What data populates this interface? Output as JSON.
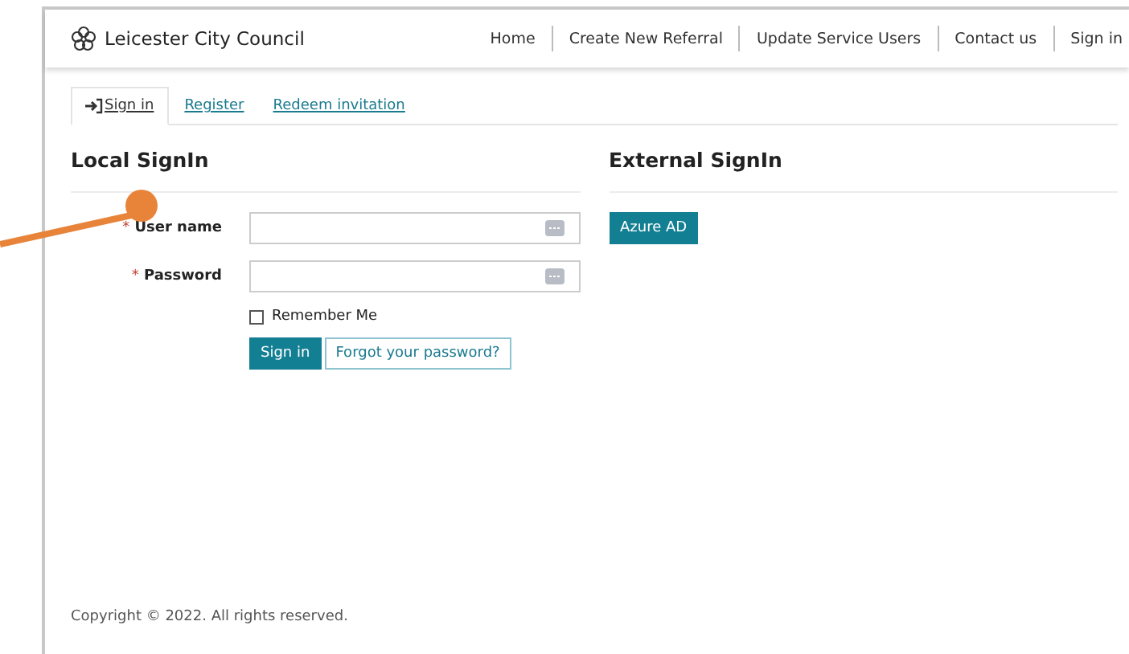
{
  "header": {
    "brand": "Leicester City Council",
    "nav": [
      {
        "label": "Home"
      },
      {
        "label": "Create New Referral"
      },
      {
        "label": "Update Service Users"
      },
      {
        "label": "Contact us"
      },
      {
        "label": "Sign in"
      }
    ]
  },
  "tabs": [
    {
      "label": "Sign in",
      "selected": true,
      "kind": "icon"
    },
    {
      "label": "Register",
      "selected": false,
      "kind": "plain"
    },
    {
      "label": "Redeem invitation",
      "selected": false,
      "kind": "plain"
    }
  ],
  "local": {
    "title": "Local SignIn",
    "fields": [
      {
        "label": "User name",
        "required_mark": "*"
      },
      {
        "label": "Password",
        "required_mark": "*"
      }
    ],
    "remember": {
      "label": "Remember Me",
      "checked": false
    },
    "submit": "Sign in",
    "forgot": "Forgot your password?"
  },
  "external": {
    "title": "External SignIn",
    "providers": [
      "Azure AD"
    ]
  },
  "footer": "Copyright © 2022. All rights reserved."
}
